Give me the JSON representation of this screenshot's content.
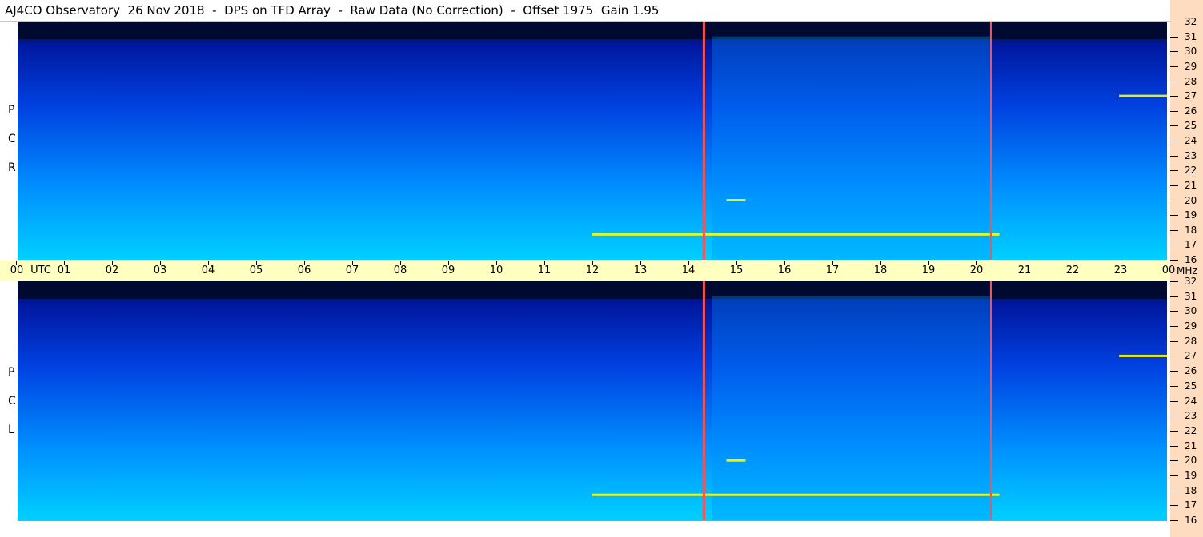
{
  "title": "AJ4CO Observatory  26 Nov 2018  -  DPS on TFD Array  -  Raw Data (No Correction)  -  Offset 1975  Gain 1.95",
  "time_axis": {
    "labels": [
      "00",
      "01",
      "02",
      "03",
      "04",
      "05",
      "06",
      "07",
      "08",
      "09",
      "10",
      "11",
      "12",
      "13",
      "14",
      "15",
      "16",
      "17",
      "18",
      "19",
      "20",
      "21",
      "22",
      "23",
      "00"
    ],
    "utc_label": "UTC",
    "mhz_label": "MHz"
  },
  "freq_labels": [
    "32",
    "31",
    "30",
    "29",
    "28",
    "27",
    "26",
    "25",
    "24",
    "23",
    "22",
    "21",
    "20",
    "19",
    "18",
    "17",
    "16"
  ],
  "panels": [
    {
      "letters": [
        "R",
        "C",
        "P"
      ]
    },
    {
      "letters": [
        "L",
        "C",
        "P"
      ]
    }
  ],
  "chart_data": {
    "type": "heatmap",
    "description_type": "dynamic spectrogram",
    "x_units": "UTC hours",
    "x_range": [
      0,
      24
    ],
    "y_units": "MHz",
    "y_range": [
      16,
      32
    ],
    "colormap": [
      "#000a30",
      "#0018a0",
      "#0040e0",
      "#0090ff",
      "#00d0ff",
      "#60ff80",
      "#ffff00",
      "#ff8000",
      "#ff0000"
    ],
    "vertical_markers_utc": [
      14.33,
      20.33
    ],
    "marker_color": "#ff5050",
    "series": [
      {
        "name": "RCP"
      },
      {
        "name": "LCP"
      }
    ],
    "intense_bands": [
      {
        "freq_mhz": 17.7,
        "utc_start": 12.0,
        "utc_end": 20.5
      },
      {
        "freq_mhz": 20.0,
        "utc_start": 14.8,
        "utc_end": 15.2
      },
      {
        "freq_mhz": 27.0,
        "utc_start": 23.0,
        "utc_end": 24.0
      }
    ]
  }
}
